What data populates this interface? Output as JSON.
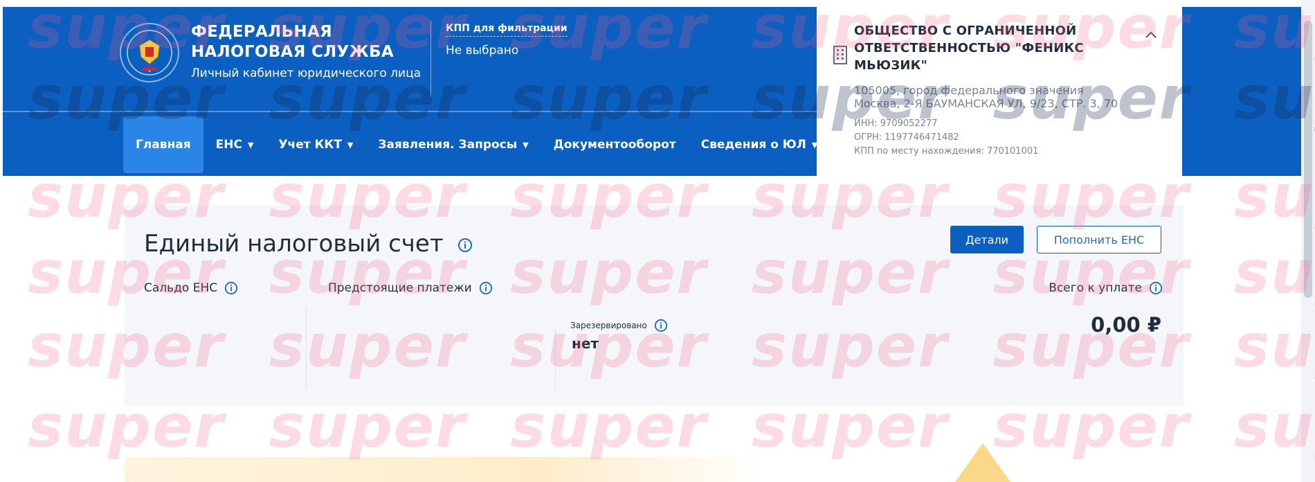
{
  "header": {
    "brand_title_line1": "ФЕДЕРАЛЬНАЯ",
    "brand_title_line2": "НАЛОГОВАЯ СЛУЖБА",
    "brand_subtitle": "Личный кабинет юридического лица",
    "kpp_filter_label": "КПП для фильтрации",
    "kpp_filter_value": "Не выбрано",
    "colors": {
      "header_bg": "#0b5fc0",
      "active_tab": "#2a85e6"
    }
  },
  "nav": {
    "items": [
      {
        "label": "Главная",
        "dropdown": false,
        "active": true
      },
      {
        "label": "ЕНС",
        "dropdown": true,
        "active": false
      },
      {
        "label": "Учет ККТ",
        "dropdown": true,
        "active": false
      },
      {
        "label": "Заявления. Запросы",
        "dropdown": true,
        "active": false
      },
      {
        "label": "Документооборот",
        "dropdown": false,
        "active": false
      },
      {
        "label": "Сведения о ЮЛ",
        "dropdown": true,
        "active": false
      }
    ]
  },
  "org": {
    "name": "ОБЩЕСТВО С ОГРАНИЧЕННОЙ ОТВЕТСТВЕННОСТЬЮ \"ФЕНИКС МЬЮЗИК\"",
    "address": "105005, город федерального значения Москва, 2-Я БАУМАНСКАЯ УЛ, 9/23, СТР. 3, 70",
    "inn": "ИНН: 9709052277",
    "ogrn": "ОГРН: 1197746471482",
    "kpp": "КПП по месту нахождения: 770101001"
  },
  "ens": {
    "title": "Единый налоговый счет",
    "details_button": "Детали",
    "topup_button": "Пополнить ЕНС",
    "saldo_label": "Сальдо ЕНС",
    "upcoming_label": "Предстоящие платежи",
    "total_label": "Всего к уплате",
    "reserved_label": "Зарезервировано",
    "reserved_value": "нет",
    "total_value": "0,00 ₽"
  },
  "watermark": {
    "text": "super"
  }
}
